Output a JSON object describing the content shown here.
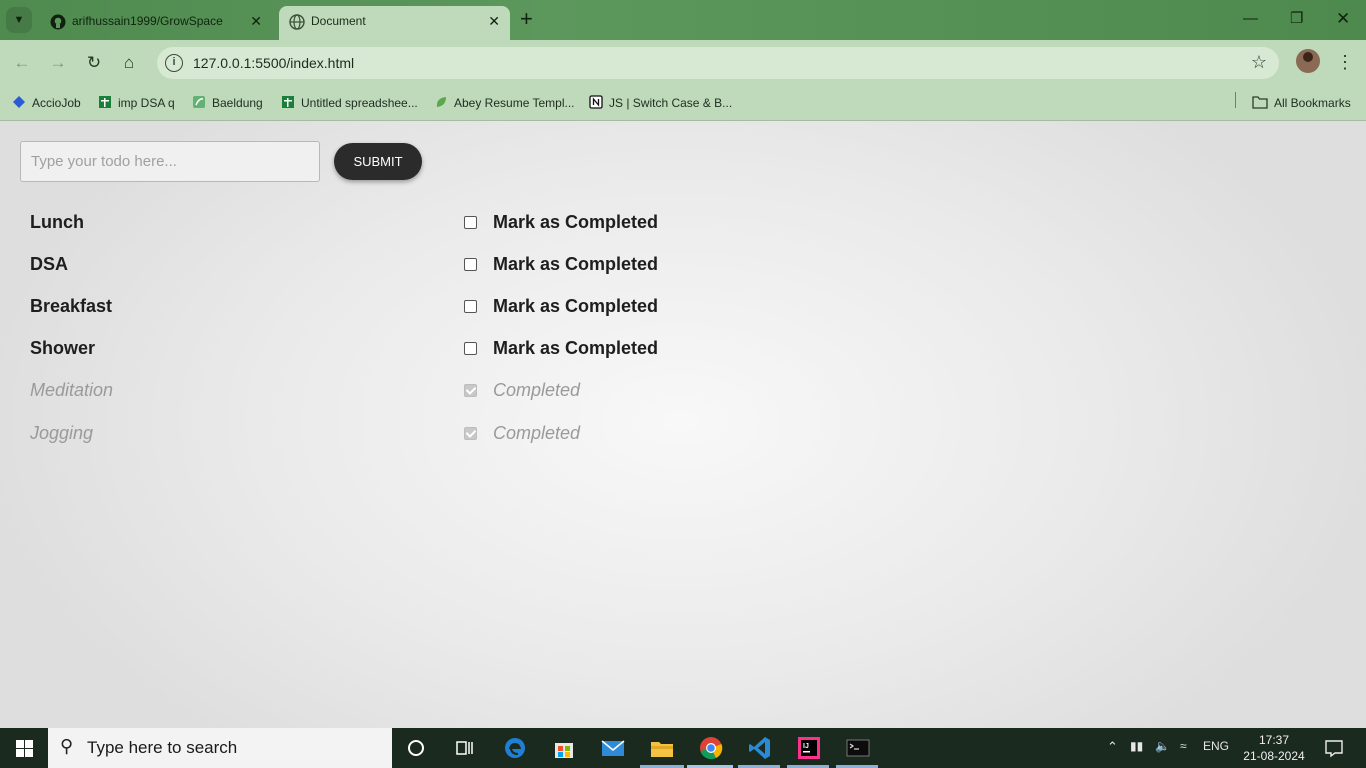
{
  "browser": {
    "tabs": [
      {
        "title": "arifhussain1999/GrowSpace",
        "icon": "github-icon",
        "active": false
      },
      {
        "title": "Document",
        "icon": "globe-icon",
        "active": true
      }
    ],
    "address": "127.0.0.1:5500/index.html",
    "bookmarks": [
      {
        "label": "AccioJob",
        "icon": "acciojob-icon"
      },
      {
        "label": "imp DSA q",
        "icon": "sheets-icon"
      },
      {
        "label": "Baeldung",
        "icon": "baeldung-icon"
      },
      {
        "label": "Untitled spreadshee...",
        "icon": "sheets-icon"
      },
      {
        "label": "Abey Resume Templ...",
        "icon": "leaf-icon"
      },
      {
        "label": "JS | Switch Case & B...",
        "icon": "notion-icon"
      }
    ],
    "all_bookmarks": "All Bookmarks"
  },
  "app": {
    "input_placeholder": "Type your todo here...",
    "submit_label": "SUBMIT",
    "todos": [
      {
        "name": "Lunch",
        "status": "Mark as Completed",
        "completed": false
      },
      {
        "name": "DSA",
        "status": "Mark as Completed",
        "completed": false
      },
      {
        "name": "Breakfast",
        "status": "Mark as Completed",
        "completed": false
      },
      {
        "name": "Shower",
        "status": "Mark as Completed",
        "completed": false
      },
      {
        "name": "Meditation",
        "status": "Completed",
        "completed": true
      },
      {
        "name": "Jogging",
        "status": "Completed",
        "completed": true
      }
    ]
  },
  "taskbar": {
    "search_placeholder": "Type here to search",
    "language": "ENG",
    "time": "17:37",
    "date": "21-08-2024"
  }
}
